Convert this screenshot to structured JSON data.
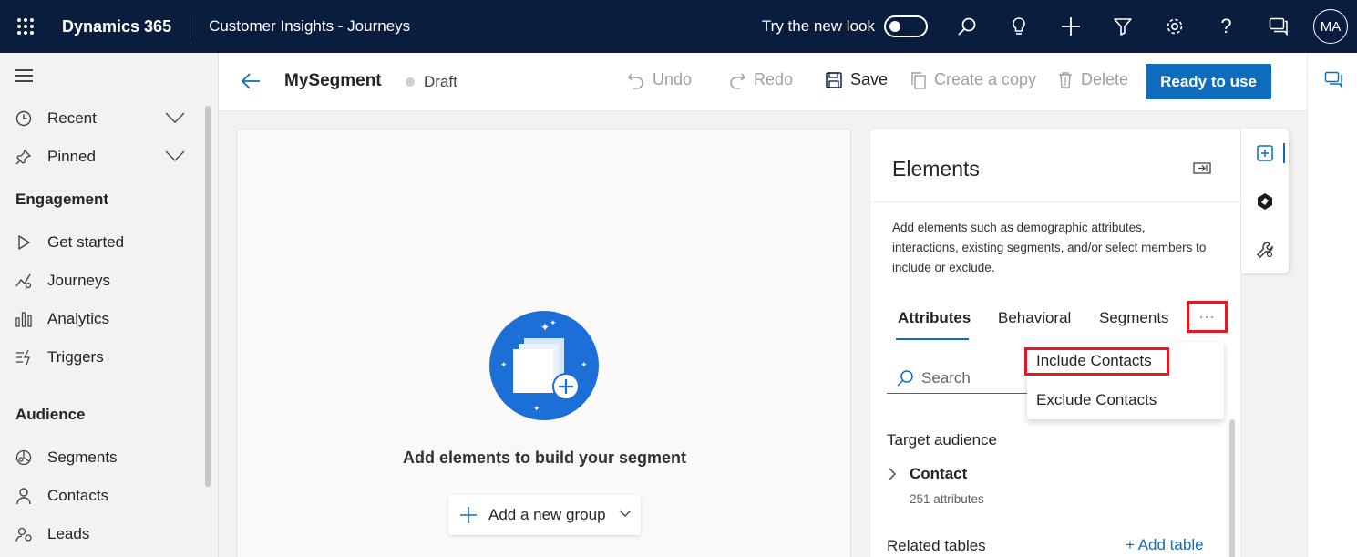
{
  "topbar": {
    "brand": "Dynamics 365",
    "app_title": "Customer Insights - Journeys",
    "try_new_look": "Try the new look",
    "avatar_initials": "MA",
    "icons": [
      "search-icon",
      "lightbulb-icon",
      "plus-icon",
      "filter-icon",
      "settings-icon",
      "help-icon",
      "feedback-icon"
    ]
  },
  "leftnav": {
    "items": [
      {
        "label": "Recent",
        "icon": "clock-icon"
      },
      {
        "label": "Pinned",
        "icon": "pin-icon"
      },
      {
        "label": "Get started",
        "icon": "play-icon"
      },
      {
        "label": "Journeys",
        "icon": "journeys-icon"
      },
      {
        "label": "Analytics",
        "icon": "analytics-icon"
      },
      {
        "label": "Triggers",
        "icon": "triggers-icon"
      },
      {
        "label": "Segments",
        "icon": "segments-icon"
      },
      {
        "label": "Contacts",
        "icon": "person-icon"
      },
      {
        "label": "Leads",
        "icon": "leads-icon"
      }
    ],
    "sections": [
      "Engagement",
      "Audience"
    ]
  },
  "cmdbar": {
    "segment_name": "MySegment",
    "status": "Draft",
    "undo": "Undo",
    "redo": "Redo",
    "save": "Save",
    "create_copy": "Create a copy",
    "delete": "Delete",
    "ready": "Ready to use"
  },
  "canvas": {
    "message": "Add elements to build your segment",
    "add_group": "Add a new group"
  },
  "panel": {
    "title": "Elements",
    "description": "Add elements such as demographic attributes, interactions, existing segments, and/or select members to include or exclude.",
    "tabs": [
      "Attributes",
      "Behavioral",
      "Segments"
    ],
    "more": "···",
    "search_placeholder": "Search",
    "target_audience": "Target audience",
    "contact": "Contact",
    "contact_attributes": "251 attributes",
    "related_tables": "Related tables",
    "add_table": "+ Add table"
  },
  "menu": {
    "items": [
      "Include Contacts",
      "Exclude Contacts"
    ]
  },
  "colors": {
    "topbar": "#0b1d3e",
    "accent": "#0f6cbd",
    "highlight": "#e01b24"
  }
}
